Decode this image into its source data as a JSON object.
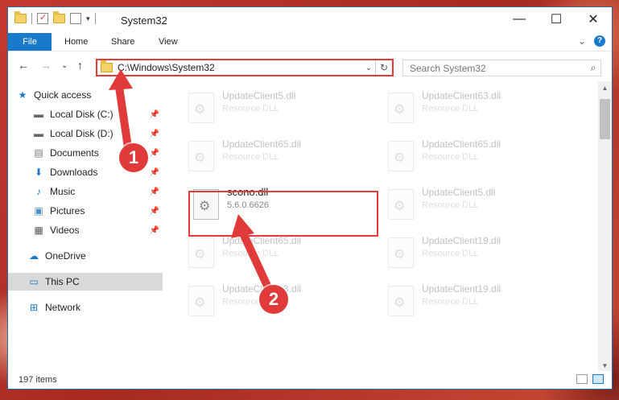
{
  "window": {
    "title": "System32",
    "controls": {
      "minimize": "—",
      "maximize": "☐",
      "close": "✕"
    }
  },
  "ribbon": {
    "tabs": [
      "File",
      "Home",
      "Share",
      "View"
    ],
    "expand": "⌄",
    "help": "?"
  },
  "address": {
    "path": "C:\\Windows\\System32",
    "dropdown": "⌄",
    "refresh": "↻"
  },
  "search": {
    "placeholder": "Search System32",
    "icon": "magnifier-icon"
  },
  "nav_buttons": {
    "back": "←",
    "forward": "→",
    "recent": "⌄",
    "up": "↑"
  },
  "navpane": {
    "items": [
      {
        "label": "Quick access",
        "icon": "star-icon",
        "pinned": false
      },
      {
        "label": "Local Disk (C:)",
        "icon": "drive-icon",
        "pinned": true
      },
      {
        "label": "Local Disk (D:)",
        "icon": "drive-icon",
        "pinned": true
      },
      {
        "label": "Documents",
        "icon": "documents-icon",
        "pinned": true
      },
      {
        "label": "Downloads",
        "icon": "download-icon",
        "pinned": true
      },
      {
        "label": "Music",
        "icon": "music-icon",
        "pinned": true
      },
      {
        "label": "Pictures",
        "icon": "pictures-icon",
        "pinned": true
      },
      {
        "label": "Videos",
        "icon": "videos-icon",
        "pinned": true
      },
      {
        "label": "OneDrive",
        "icon": "cloud-icon",
        "pinned": false
      },
      {
        "label": "This PC",
        "icon": "computer-icon",
        "pinned": false
      },
      {
        "label": "Network",
        "icon": "network-icon",
        "pinned": false
      }
    ]
  },
  "files": [
    {
      "name": "UpdateClient5.dll",
      "type": "Resource DLL",
      "ghost": true
    },
    {
      "name": "UpdateClient63.dll",
      "type": "Resource DLL",
      "ghost": true
    },
    {
      "name": "UpdateClient65.dll",
      "type": "Resource DLL",
      "ghost": true
    },
    {
      "name": "UpdateClient65.dll",
      "type": "Resource DLL",
      "ghost": true
    },
    {
      "name": "scono.dll",
      "type": "5.6.0.6626",
      "ghost": false
    },
    {
      "name": "UpdateClient5.dll",
      "type": "Resource DLL",
      "ghost": true
    },
    {
      "name": "UpdateClient65.dll",
      "type": "Resource DLL",
      "ghost": true
    },
    {
      "name": "UpdateClient19.dll",
      "type": "Resource DLL",
      "ghost": true
    },
    {
      "name": "UpdateClient63.dll",
      "type": "Resource DLL",
      "ghost": true
    },
    {
      "name": "UpdateClient19.dll",
      "type": "Resource DLL",
      "ghost": true
    }
  ],
  "status": {
    "count": "197 items"
  },
  "annotations": {
    "step1": "1",
    "step2": "2"
  },
  "colors": {
    "accent": "#1979ca",
    "highlight": "#e53b3b",
    "badge": "#e03a3a"
  }
}
